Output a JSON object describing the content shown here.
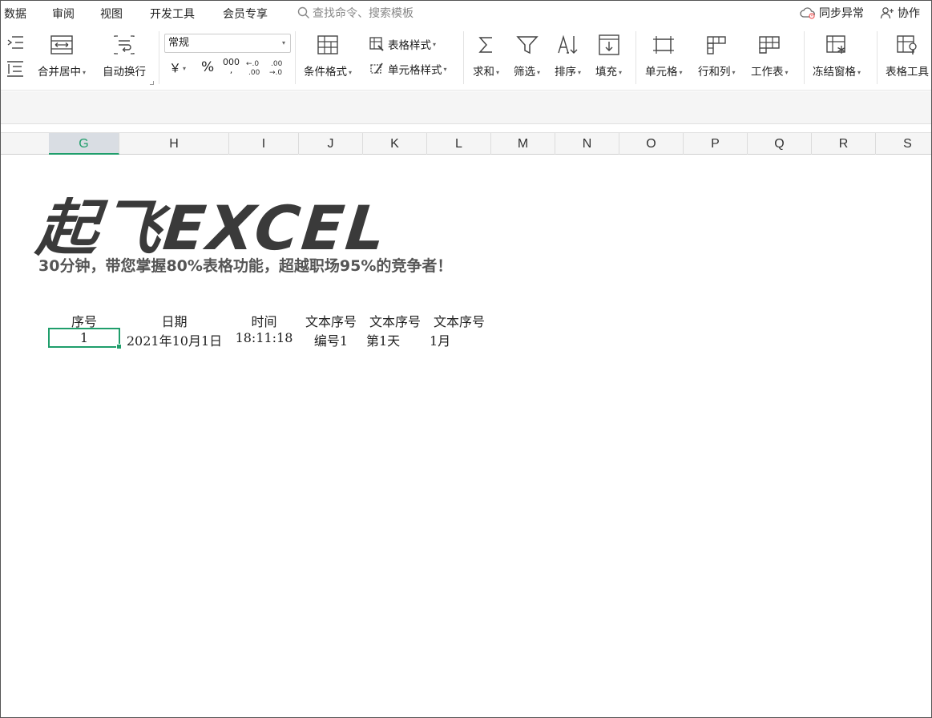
{
  "menu": {
    "items": [
      "数据",
      "审阅",
      "视图",
      "开发工具",
      "会员专享"
    ],
    "search_placeholder": "查找命令、搜索模板",
    "sync_status": "同步异常",
    "collab": "协作"
  },
  "ribbon": {
    "merge_center": "合并居中",
    "wrap_text": "自动换行",
    "number_format": "常规",
    "currency_symbol": "￥",
    "percent_symbol": "%",
    "thousands_symbol": "000",
    "cond_format": "条件格式",
    "table_style": "表格样式",
    "cell_style": "单元格样式",
    "sum": "求和",
    "filter": "筛选",
    "sort": "排序",
    "fill": "填充",
    "cell": "单元格",
    "row_col": "行和列",
    "worksheet": "工作表",
    "freeze": "冻结窗格",
    "table_tools": "表格工具"
  },
  "columns": [
    "G",
    "H",
    "I",
    "J",
    "K",
    "L",
    "M",
    "N",
    "O",
    "P",
    "Q",
    "R",
    "S"
  ],
  "selected_column": "G",
  "banner": {
    "logo": "起飞EXCEL",
    "tagline": "30分钟，带您掌握80%表格功能，超越职场95%的竞争者！"
  },
  "table": {
    "headers": [
      "序号",
      "日期",
      "时间",
      "文本序号",
      "文本序号",
      "文本序号"
    ],
    "row1": [
      "1",
      "2021年10月1日",
      "18:11:18",
      "编号1",
      "第1天",
      "1月"
    ]
  }
}
